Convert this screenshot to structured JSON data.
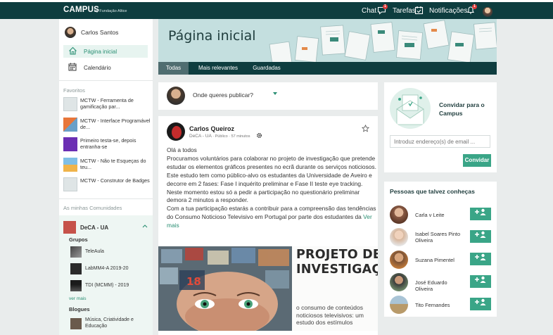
{
  "topbar": {
    "brand": "CAMPUS",
    "brand_sub": "by Fundação Altice",
    "chat_label": "Chat",
    "chat_badge": "1",
    "tasks_label": "Tarefas",
    "notifications_label": "Notificações",
    "notifications_badge": "1"
  },
  "sidebar": {
    "user_name": "Carlos Santos",
    "nav": [
      {
        "label": "Página inicial",
        "icon": "home-icon",
        "active": true
      },
      {
        "label": "Calendário",
        "icon": "calendar-icon",
        "active": false
      }
    ],
    "favorites_title": "Favoritos",
    "favorites": [
      {
        "label": "MCTW - Ferramenta de gamificação par..."
      },
      {
        "label": "MCTW - Interface Programável de..."
      },
      {
        "label": "Primeiro testa-se, depois entranha-se"
      },
      {
        "label": "MCTW - Não te Esqueças do teu..."
      },
      {
        "label": "MCTW - Construtor de Badges"
      }
    ],
    "communities_title": "As minhas Comunidades",
    "community_name": "DeCA - UA",
    "groups_title": "Grupos",
    "groups": [
      {
        "label": "TeleAula"
      },
      {
        "label": "LabMM4-A 2019-20"
      },
      {
        "label": "TDI (MCMM) - 2019"
      }
    ],
    "see_more": "ver mais",
    "blogs_title": "Blogues",
    "blogs": [
      {
        "label": "Música, Criatividade e Educação"
      }
    ]
  },
  "header": {
    "title": "Página inicial",
    "tabs": [
      {
        "label": "Todas",
        "active": true
      },
      {
        "label": "Mais relevantes",
        "active": false
      },
      {
        "label": "Guardadas",
        "active": false
      }
    ]
  },
  "publish": {
    "placeholder": "Onde queres publicar?"
  },
  "post": {
    "author": "Carlos Queiroz",
    "community": "DeCA - UA",
    "visibility": "Público",
    "time": "57 minutos",
    "greeting": "Olá a todos",
    "body": "Procuramos voluntários para colaborar no projeto de investigação que pretende estudar os elementos gráficos presentes no ecrã durante os serviços noticiosos. Este estudo tem como público-alvo os estudantes da Universidade de Aveiro e decorre em 2 fases: Fase I inquérito preliminar e Fase II teste eye tracking. Neste momento estou só a pedir a participação no questionário preliminar demora 2 minutos a responder.",
    "body2": "Com a tua participação estarás a contribuir para a compreensão das tendências do Consumo Noticioso Televisivo em Portugal por parte dos estudantes da",
    "see_more": "Ver mais",
    "image_title": "PROJETO DE INVESTIGAÇÃO",
    "image_subtitle": "o consumo de conteúdos noticiosos televisivos: um estudo dos estímulos",
    "image_number": "18"
  },
  "invite": {
    "title": "Convidar para o Campus",
    "email_placeholder": "Introduz endereço(s) de email ...",
    "button": "Convidar"
  },
  "people": {
    "title": "Pessoas que talvez conheças",
    "list": [
      {
        "name": "Carla v Leite",
        "avatar_color": "#8a5a44"
      },
      {
        "name": "Isabel Soares Pinto Oliveira",
        "avatar_color": "#c9a98d"
      },
      {
        "name": "Suzana Pimentel",
        "avatar_color": "#7a5236"
      },
      {
        "name": "José Eduardo Oliveira",
        "avatar_color": "#4c5b4a"
      },
      {
        "name": "Tito Fernandes",
        "avatar_color": "#9aa4a8"
      }
    ]
  },
  "colors": {
    "topbar": "#0e3d3f",
    "accent": "#3aa587",
    "banner": "#c4dfdf",
    "background": "#e9ecec"
  }
}
